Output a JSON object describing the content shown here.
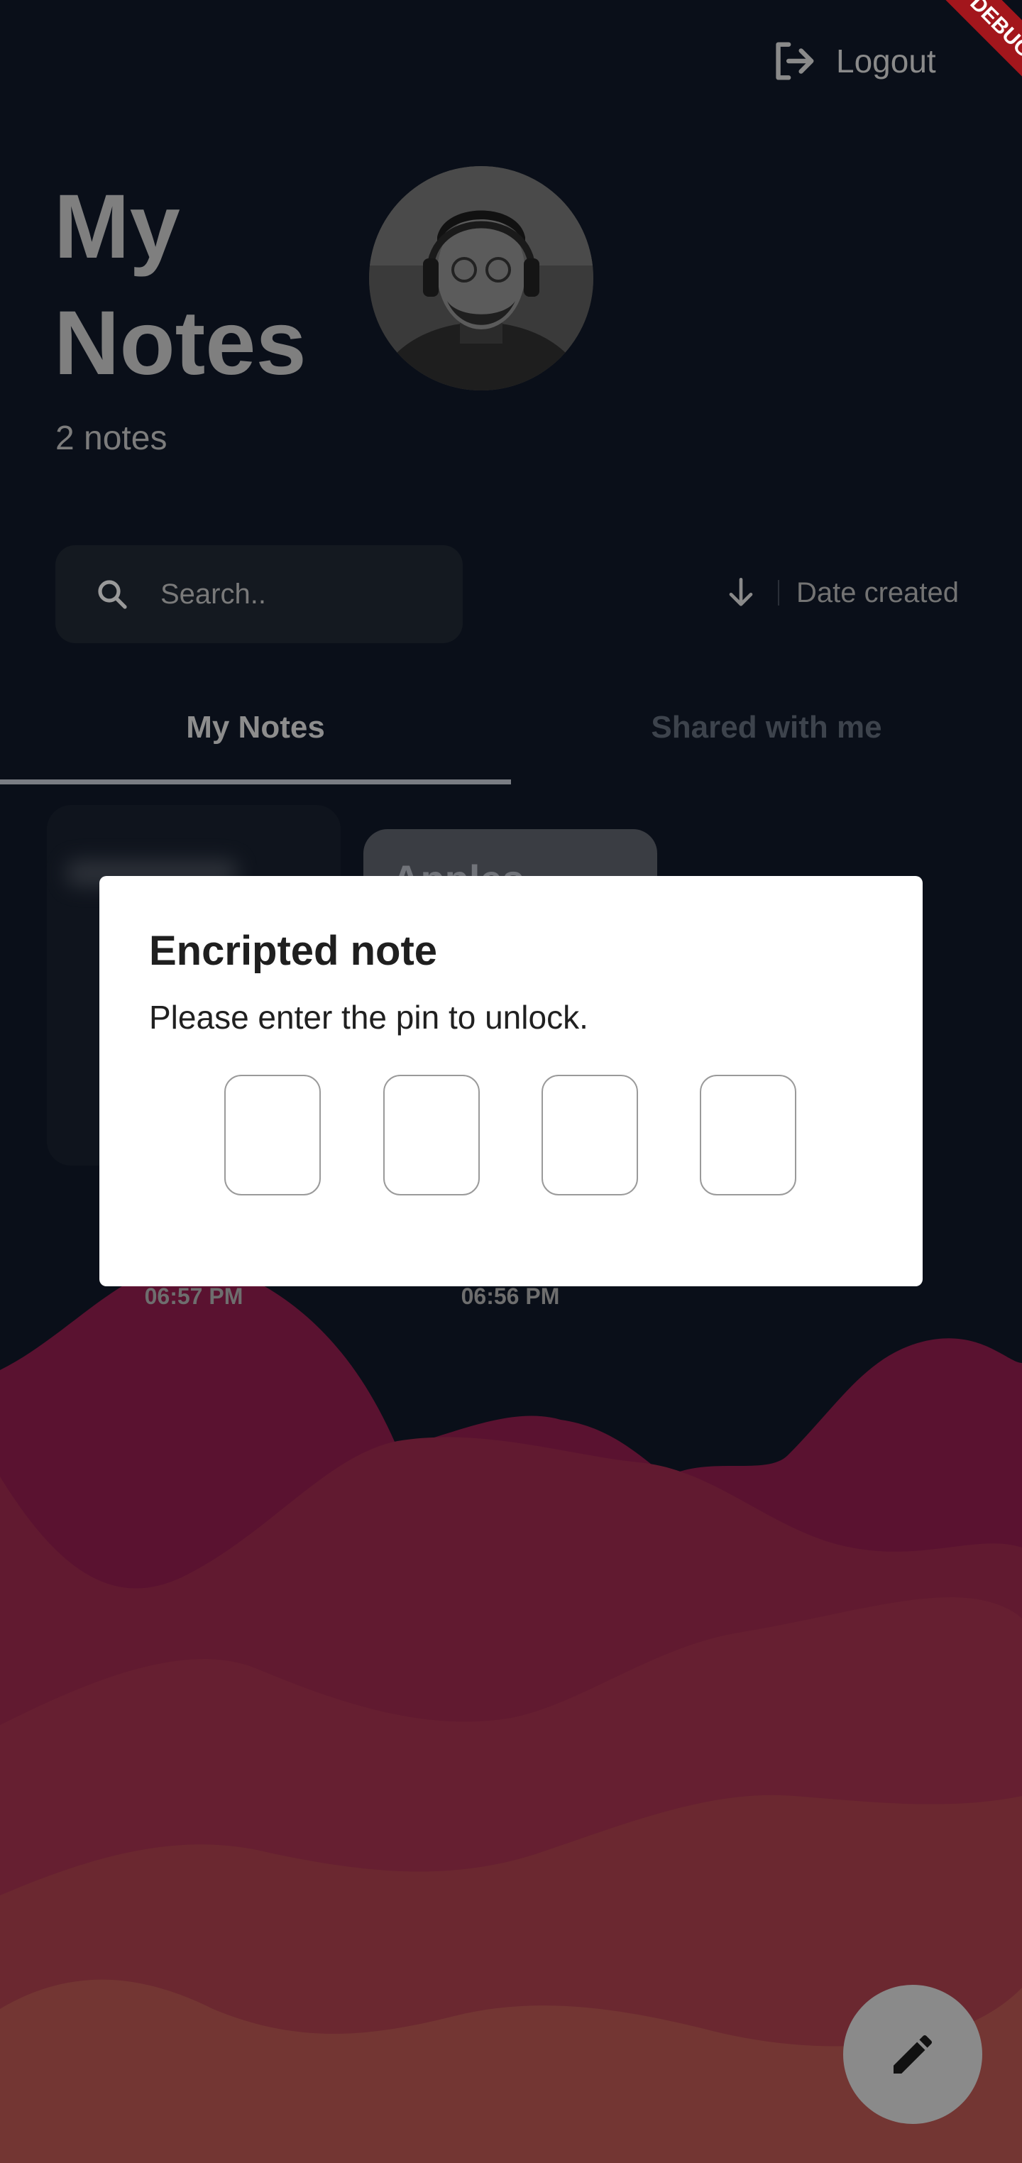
{
  "header": {
    "logout_label": "Logout",
    "debug_banner": "DEBUG",
    "title_line1": "My",
    "title_line2": "Notes",
    "note_count": "2 notes"
  },
  "search": {
    "placeholder": "Search..",
    "value": ""
  },
  "sort": {
    "label": "Date created",
    "direction_icon": "arrow-down-icon"
  },
  "tabs": [
    {
      "label": "My Notes",
      "active": true
    },
    {
      "label": "Shared with me",
      "active": false
    }
  ],
  "notes": [
    {
      "title": "",
      "time": "06:57 PM",
      "encrypted": true
    },
    {
      "title": "Apples",
      "time": "06:56 PM",
      "encrypted": false
    }
  ],
  "dialog": {
    "title": "Encripted note",
    "message": "Please enter the pin to unlock.",
    "pin_values": [
      "",
      "",
      "",
      ""
    ]
  },
  "fab": {
    "icon": "pencil-icon"
  },
  "colors": {
    "background": "#0a0f19",
    "dialog": "#ffffff",
    "wave_dark": "#5a1230",
    "wave_light": "#733633",
    "fab": "#8a8a8a"
  }
}
